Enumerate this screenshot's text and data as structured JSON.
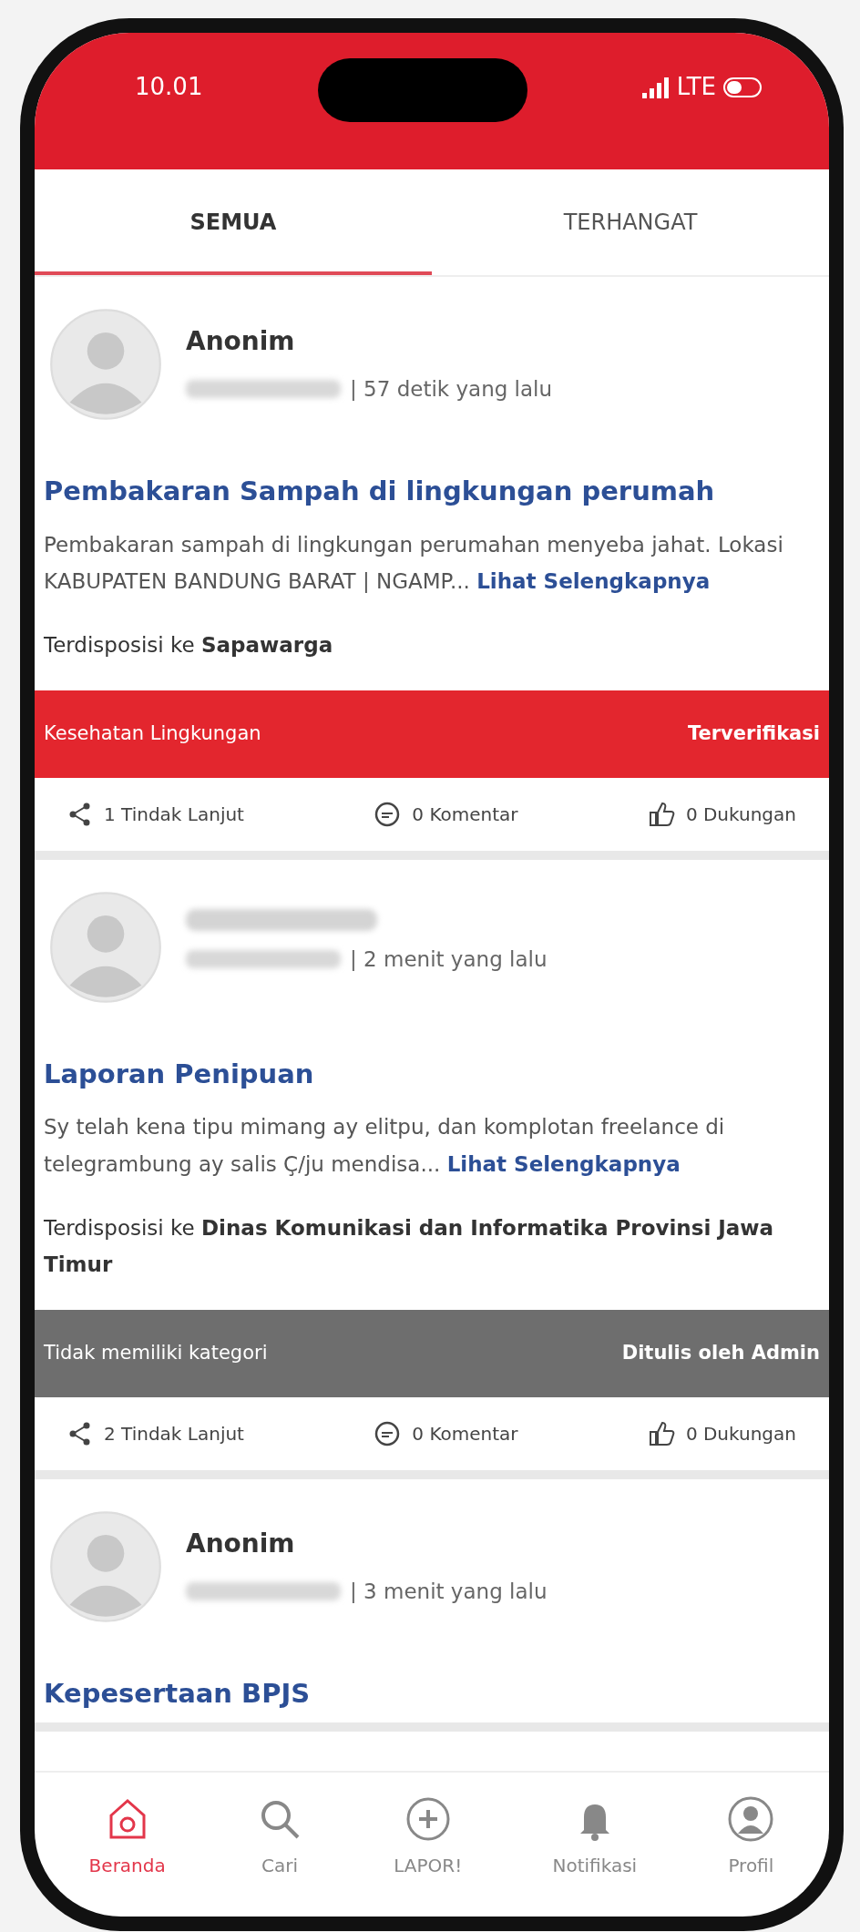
{
  "status_bar": {
    "time": "10.01",
    "network": "LTE"
  },
  "tabs": [
    {
      "label": "SEMUA",
      "selected": true
    },
    {
      "label": "TERHANGAT",
      "selected": false
    }
  ],
  "posts": [
    {
      "author": "Anonim",
      "author_blurred": false,
      "time": "| 57 detik yang lalu",
      "title": "Pembakaran Sampah di lingkungan perumah",
      "description": "Pembakaran sampah di lingkungan perumahan menyeba jahat. Lokasi KABUPATEN BANDUNG BARAT | NGAMP... ",
      "more_link": "Lihat Selengkapnya",
      "disposition": "Terdisposisi ke **Sapawarga**",
      "category": "Kesehatan Lingkungan",
      "status": "Terverifikasi",
      "color": "#e3262e",
      "actions": [
        "1 Tindak Lanjut",
        "0 Komentar",
        "0 Dukungan"
      ]
    },
    {
      "author_blurred": true,
      "time": "| 2 menit yang lalu",
      "title": "Laporan Penipuan",
      "description": "Sy telah kena tipu mimang ay elitpu, dan komplotan freelance di telegrambung ay salis Ç/ju mendisa... ",
      "more_link": "Lihat Selengkapnya",
      "disposition": "Terdisposisi ke **Dinas Komunikasi dan Informatika Provinsi Jawa Timur**",
      "category": "Tidak memiliki kategori",
      "status": "Ditulis oleh Admin",
      "color": "#6e6e6e",
      "actions": [
        "2 Tindak Lanjut",
        "0 Komentar",
        "0 Dukungan"
      ]
    },
    {
      "author": "Anonim",
      "author_blurred": false,
      "time": "| 3 menit yang lalu",
      "title": "Kepesertaan BPJS"
    }
  ],
  "bottom_nav": [
    {
      "label": "Beranda",
      "selected": true
    },
    {
      "label": "Cari",
      "selected": false
    },
    {
      "label": "LAPOR!",
      "selected": false
    },
    {
      "label": "Notifikasi",
      "selected": false
    },
    {
      "label": "Profil",
      "selected": false
    }
  ]
}
